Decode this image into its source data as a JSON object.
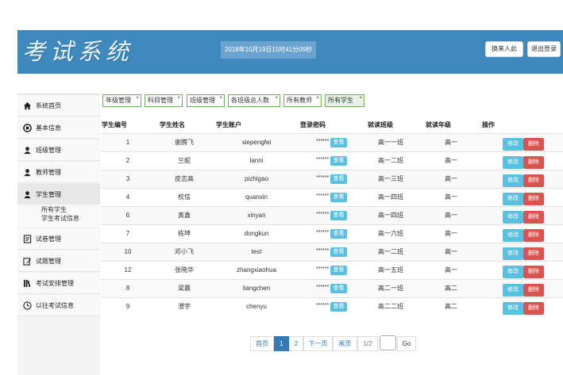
{
  "header": {
    "logo": "考试系统",
    "datetime": "2018年10月19日15时41分09秒",
    "button_enter": "换来人此",
    "button_logout": "退出登录"
  },
  "sidebar": {
    "items": [
      {
        "label": "系统首页",
        "icon": "home-icon"
      },
      {
        "label": "基本信息",
        "icon": "info-icon"
      },
      {
        "label": "班级管理",
        "icon": "user-icon"
      },
      {
        "label": "教师管理",
        "icon": "user-icon"
      },
      {
        "label": "学生管理",
        "icon": "user-icon"
      },
      {
        "label": "试卷管理",
        "icon": "list-icon"
      },
      {
        "label": "试题管理",
        "icon": "edit-icon"
      },
      {
        "label": "考试安排管理",
        "icon": "books-icon"
      },
      {
        "label": "以往考试信息",
        "icon": "clock-icon"
      }
    ],
    "sub_items": [
      "所有学生",
      "学生考试信息"
    ]
  },
  "filters": [
    "年级管理",
    "科目管理",
    "班级管理",
    "各班级总人数",
    "所有教师",
    "所有学生"
  ],
  "table": {
    "headers": [
      "学生编号",
      "学生姓名",
      "学生账户",
      "登录密码",
      "就读班级",
      "就读年级",
      "操作"
    ],
    "password_mask": "******",
    "view_label": "查看",
    "edit_label": "修改",
    "delete_label": "删除",
    "rows": [
      {
        "id": "1",
        "name": "谢腾飞",
        "account": "xiepengfei",
        "class": "高一一班",
        "grade": "高一"
      },
      {
        "id": "2",
        "name": "兰妮",
        "account": "lanni",
        "class": "高一二班",
        "grade": "高一"
      },
      {
        "id": "3",
        "name": "皮志高",
        "account": "pizhigao",
        "class": "高一三班",
        "grade": "高一"
      },
      {
        "id": "4",
        "name": "权信",
        "account": "quanxin",
        "class": "高一四班",
        "grade": "高一"
      },
      {
        "id": "6",
        "name": "寅鑫",
        "account": "xinyan",
        "class": "高一四班",
        "grade": "高一"
      },
      {
        "id": "7",
        "name": "栋坤",
        "account": "dongkun",
        "class": "高一六班",
        "grade": "高一"
      },
      {
        "id": "10",
        "name": "邓小飞",
        "account": "test",
        "class": "高一二班",
        "grade": "高一"
      },
      {
        "id": "12",
        "name": "张晓华",
        "account": "zhangxiaohua",
        "class": "高一五班",
        "grade": "高一"
      },
      {
        "id": "8",
        "name": "梁晨",
        "account": "liangchen",
        "class": "高二一班",
        "grade": "高二"
      },
      {
        "id": "9",
        "name": "澄宇",
        "account": "chenyu",
        "class": "高二二班",
        "grade": "高二"
      }
    ]
  },
  "pagination": {
    "first": "首页",
    "page1": "1",
    "page2": "2",
    "next": "下一页",
    "last": "尾页",
    "info": "1/2",
    "go": "Go"
  },
  "colors": {
    "header_bg": "#3f88bc",
    "info_btn": "#5bc0de",
    "danger_btn": "#d9534f",
    "tag_border": "#6fae5d",
    "active_page": "#337ab7"
  }
}
